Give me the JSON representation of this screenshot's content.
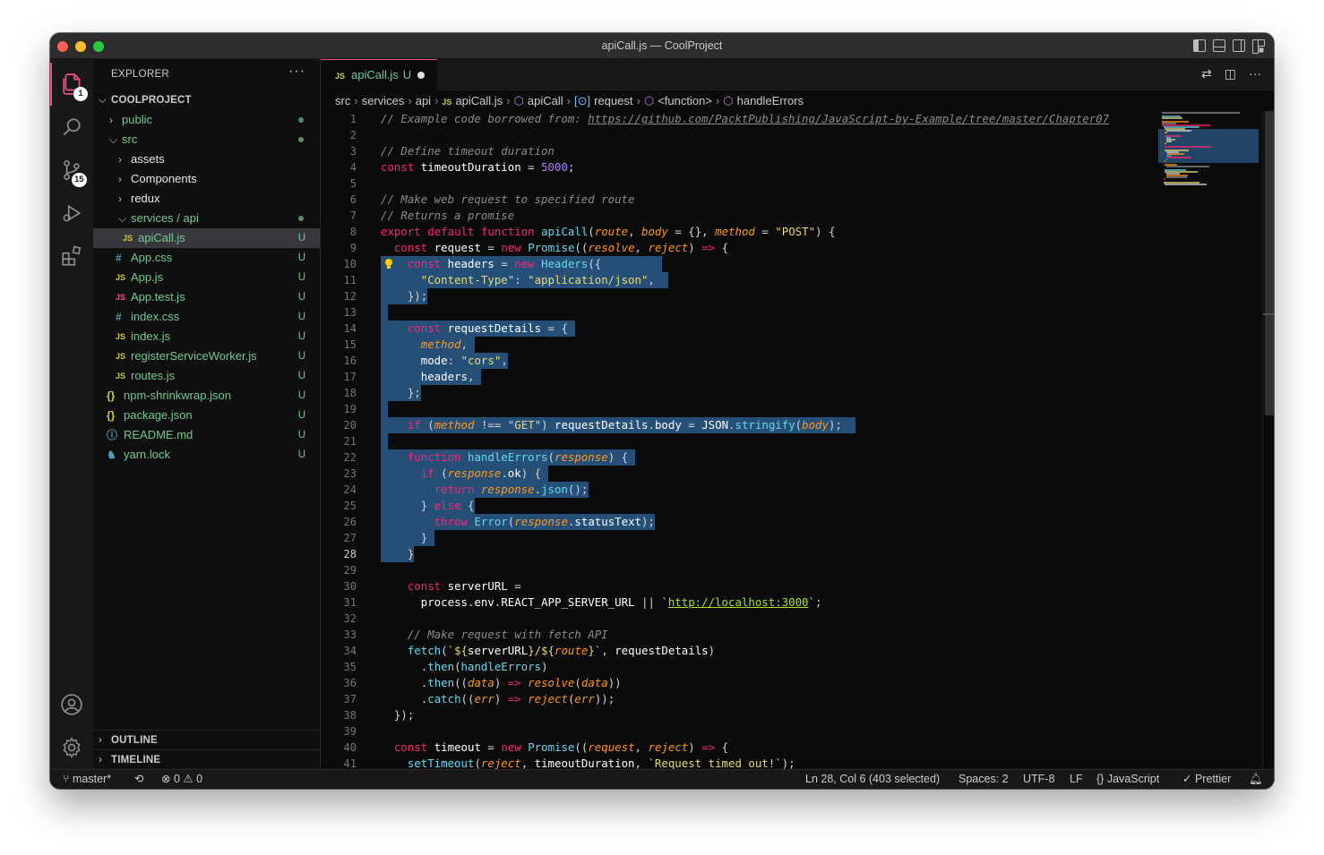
{
  "window": {
    "title": "apiCall.js — CoolProject"
  },
  "activity": {
    "explorer_badge": "1",
    "scm_badge": "15"
  },
  "sidebar": {
    "header": "EXPLORER",
    "more": "···",
    "project": "COOLPROJECT",
    "items": [
      {
        "name": "public",
        "kind": "folder",
        "status": ""
      },
      {
        "name": "src",
        "kind": "folder-open",
        "status": ""
      },
      {
        "name": "assets",
        "kind": "folder",
        "status": ""
      },
      {
        "name": "Components",
        "kind": "folder",
        "status": ""
      },
      {
        "name": "redux",
        "kind": "folder",
        "status": ""
      },
      {
        "name": "services / api",
        "kind": "folder-open",
        "status": ""
      },
      {
        "name": "apiCall.js",
        "kind": "js",
        "status": "U"
      },
      {
        "name": "App.css",
        "kind": "css",
        "status": "U"
      },
      {
        "name": "App.js",
        "kind": "js",
        "status": "U"
      },
      {
        "name": "App.test.js",
        "kind": "js-test",
        "status": "U"
      },
      {
        "name": "index.css",
        "kind": "css",
        "status": "U"
      },
      {
        "name": "index.js",
        "kind": "js",
        "status": "U"
      },
      {
        "name": "registerServiceWorker.js",
        "kind": "js",
        "status": "U"
      },
      {
        "name": "routes.js",
        "kind": "js",
        "status": "U"
      },
      {
        "name": "npm-shrinkwrap.json",
        "kind": "json",
        "status": "U"
      },
      {
        "name": "package.json",
        "kind": "json",
        "status": "U"
      },
      {
        "name": "README.md",
        "kind": "info",
        "status": "U"
      },
      {
        "name": "yarn.lock",
        "kind": "yarn",
        "status": "U"
      }
    ],
    "outline": "OUTLINE",
    "timeline": "TIMELINE"
  },
  "tab": {
    "label": "apiCall.js",
    "icon": "JS",
    "status": "U"
  },
  "breadcrumb": [
    "src",
    "services",
    "api",
    "apiCall.js",
    "apiCall",
    "request",
    "<function>",
    "handleErrors"
  ],
  "editor": {
    "current_line": 28,
    "lines": [
      "// Example code borrowed from: https://github.com/PacktPublishing/JavaScript-by-Example/tree/master/Chapter07",
      "",
      "// Define timeout duration",
      "const timeoutDuration = 5000;",
      "",
      "// Make web request to specified route",
      "// Returns a promise",
      "export default function apiCall(route, body = {}, method = \"POST\") {",
      "  const request = new Promise((resolve, reject) => {",
      "    const headers = new Headers({",
      "      \"Content-Type\": \"application/json\",",
      "    });",
      "",
      "    const requestDetails = {",
      "      method,",
      "      mode: \"cors\",",
      "      headers,",
      "    };",
      "",
      "    if (method !== \"GET\") requestDetails.body = JSON.stringify(body);",
      "",
      "    function handleErrors(response) {",
      "      if (response.ok) {",
      "        return response.json();",
      "      } else {",
      "        throw Error(response.statusText);",
      "      }",
      "    }",
      "",
      "    const serverURL =",
      "      process.env.REACT_APP_SERVER_URL || `http://localhost:3000`;",
      "",
      "    // Make request with fetch API",
      "    fetch(`${serverURL}/${route}`, requestDetails)",
      "      .then(handleErrors)",
      "      .then((data) => resolve(data))",
      "      .catch((err) => reject(err));",
      "  });",
      "",
      "  const timeout = new Promise((request, reject) => {",
      "    setTimeout(reject, timeoutDuration, `Request timed out!`);"
    ]
  },
  "status": {
    "branch": "master*",
    "errors": "0",
    "warnings": "0",
    "position": "Ln 28, Col 6 (403 selected)",
    "spaces": "Spaces: 2",
    "encoding": "UTF-8",
    "eol": "LF",
    "language": "JavaScript",
    "formatter": "Prettier"
  },
  "colors": {
    "accent": "#f14c8a",
    "untracked": "#73c991",
    "selection": "#264f78"
  }
}
